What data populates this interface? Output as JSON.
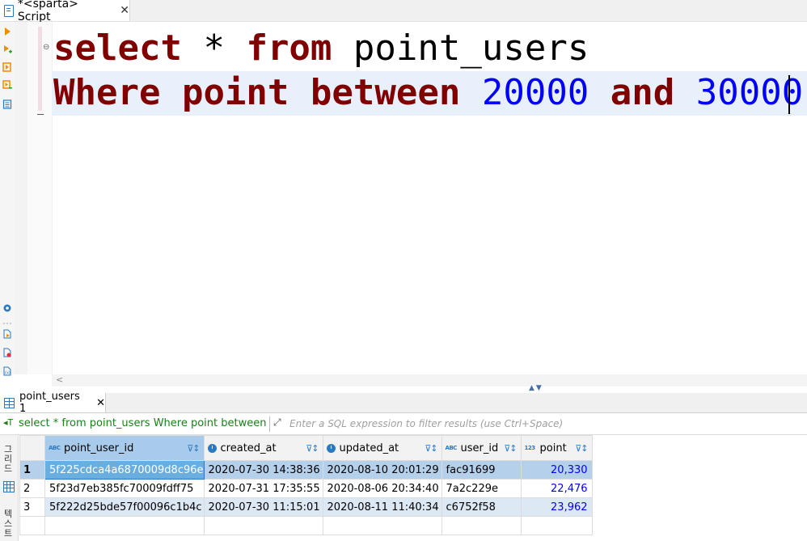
{
  "editor_tab": {
    "label": "*<sparta> Script",
    "close": "✕"
  },
  "sql": {
    "line1": {
      "kw1": "select",
      "star": "*",
      "kw2": "from",
      "table": "point_users"
    },
    "line2": {
      "kw1": "Where",
      "col": "point",
      "kw2": "between",
      "low": "20000",
      "kw3": "and",
      "high": "30000"
    }
  },
  "results_tab": {
    "label": "point_users 1",
    "close": "✕"
  },
  "filter": {
    "icon": "◂T",
    "query": "select * from point_users Where point between 2",
    "placeholder": "Enter a SQL expression to filter results (use Ctrl+Space)"
  },
  "side_panel": {
    "grid_label": "그리드",
    "text_label": "텍스트"
  },
  "grid": {
    "columns": [
      {
        "name": "point_user_id",
        "type_icon": "ABC"
      },
      {
        "name": "created_at",
        "type_icon": "clock"
      },
      {
        "name": "updated_at",
        "type_icon": "clock"
      },
      {
        "name": "user_id",
        "type_icon": "ABC"
      },
      {
        "name": "point",
        "type_icon": "123"
      }
    ],
    "rows": [
      {
        "n": "1",
        "point_user_id": "5f225cdca4a6870009d8c96e",
        "created_at": "2020-07-30 14:38:36",
        "updated_at": "2020-08-10 20:01:29",
        "user_id": "fac91699",
        "point": "20,330"
      },
      {
        "n": "2",
        "point_user_id": "5f23d7eb385fc70009fdff75",
        "created_at": "2020-07-31 17:35:55",
        "updated_at": "2020-08-06 20:34:40",
        "user_id": "7a2c229e",
        "point": "22,476"
      },
      {
        "n": "3",
        "point_user_id": "5f222d25bde57f00096c1b4c",
        "created_at": "2020-07-30 11:15:01",
        "updated_at": "2020-08-11 11:40:34",
        "user_id": "c6752f58",
        "point": "23,962"
      }
    ]
  },
  "colors": {
    "keyword": "#800000",
    "number": "#0000ff",
    "accent": "#2b79c2",
    "selection": "#b5d0ea"
  }
}
